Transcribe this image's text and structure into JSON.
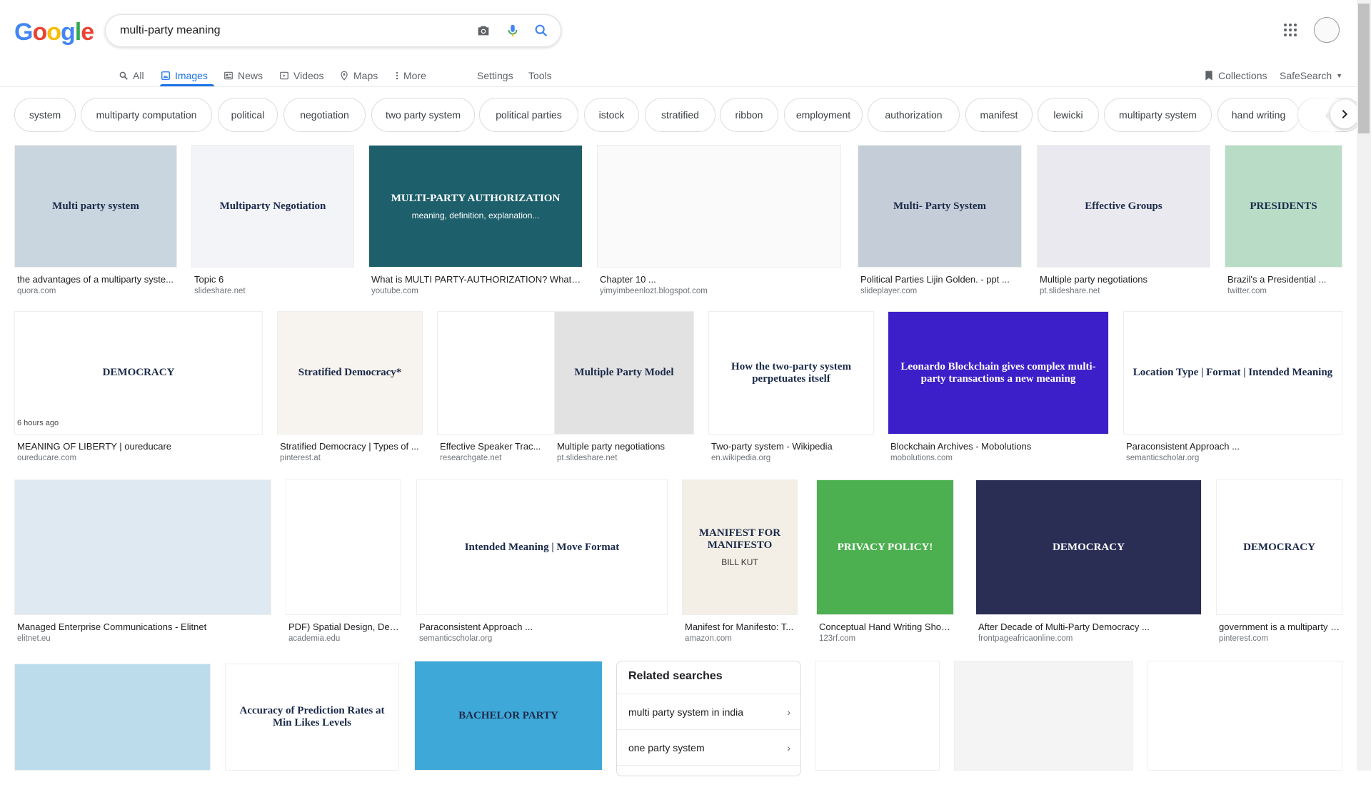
{
  "logo_letters": [
    "G",
    "o",
    "o",
    "g",
    "l",
    "e"
  ],
  "search": {
    "query": "multi-party meaning"
  },
  "tabs": [
    {
      "label": "All",
      "icon": "search-icon"
    },
    {
      "label": "Images",
      "icon": "image-icon"
    },
    {
      "label": "News",
      "icon": "news-icon"
    },
    {
      "label": "Videos",
      "icon": "video-icon"
    },
    {
      "label": "Maps",
      "icon": "map-pin-icon"
    },
    {
      "label": "More",
      "icon": "more-vert-icon"
    }
  ],
  "tools": {
    "settings": "Settings",
    "tools": "Tools",
    "collections": "Collections",
    "safesearch": "SafeSearch"
  },
  "chips": [
    "system",
    "multiparty computation",
    "political",
    "negotiation",
    "two party system",
    "political parties",
    "istock",
    "stratified",
    "ribbon",
    "employment",
    "authorization",
    "manifest",
    "lewicki",
    "multiparty system",
    "hand writing",
    "el"
  ],
  "results": [
    {
      "title": "the advantages of a multiparty syste...",
      "source": "quora.com",
      "thumb": {
        "bg": "#c9d6df",
        "text": "Multi party system"
      }
    },
    {
      "title": "Topic 6",
      "source": "slideshare.net",
      "thumb": {
        "bg": "#f2f4f7",
        "text": "Multiparty Negotiation"
      }
    },
    {
      "title": "What is MULTI PARTY-AUTHORIZATION? What ...",
      "source": "youtube.com",
      "thumb": {
        "bg": "#1d5f6b",
        "text": "MULTI-PARTY AUTHORIZATION",
        "sub": "meaning, definition, explanation..."
      }
    },
    {
      "title": "Chapter 10 ...",
      "source": "yimyimbeenlozt.blogspot.com",
      "thumb": {
        "bg": "#fafafa",
        "text": ""
      }
    },
    {
      "title": "Political Parties Lijin Golden. - ppt ...",
      "source": "slideplayer.com",
      "thumb": {
        "bg": "#c5ced8",
        "text": "Multi- Party System"
      }
    },
    {
      "title": "Multiple party negotiations",
      "source": "pt.slideshare.net",
      "thumb": {
        "bg": "#e9e9ef",
        "text": "Effective Groups"
      }
    },
    {
      "title": "Brazil's a Presidential ...",
      "source": "twitter.com",
      "thumb": {
        "bg": "#b8dcc6",
        "text": "PRESIDENTS"
      }
    },
    {
      "title": "MEANING OF LIBERTY | oureducare",
      "source": "oureducare.com",
      "thumb": {
        "bg": "#ffffff",
        "text": "DEMOCRACY"
      },
      "badge": "6 hours ago"
    },
    {
      "title": "Stratified Democracy | Types of ...",
      "source": "pinterest.at",
      "thumb": {
        "bg": "#f7f3ee",
        "text": "Stratified Democracy*"
      }
    },
    {
      "title": "Effective Speaker Trac...",
      "source": "researchgate.net",
      "thumb": {
        "bg": "#ffffff",
        "text": ""
      }
    },
    {
      "title": "Multiple party negotiations",
      "source": "pt.slideshare.net",
      "thumb": {
        "bg": "#e2e2e2",
        "text": "Multiple Party Model"
      }
    },
    {
      "title": "Two-party system - Wikipedia",
      "source": "en.wikipedia.org",
      "thumb": {
        "bg": "#ffffff",
        "text": "How the two-party system perpetuates itself"
      }
    },
    {
      "title": "Blockchain Archives - Mobolutions",
      "source": "mobolutions.com",
      "thumb": {
        "bg": "#3c1fc9",
        "text": "Leonardo Blockchain gives complex multi-party transactions a new meaning"
      }
    },
    {
      "title": "Paraconsistent Approach ...",
      "source": "semanticscholar.org",
      "thumb": {
        "bg": "#ffffff",
        "text": "Location Type | Format | Intended Meaning"
      }
    },
    {
      "title": "Managed Enterprise Communications - Elitnet",
      "source": "elitnet.eu",
      "thumb": {
        "bg": "#dfe9f1",
        "text": ""
      }
    },
    {
      "title": "PDF) Spatial Design, Des...",
      "source": "academia.edu",
      "thumb": {
        "bg": "#ffffff",
        "text": ""
      }
    },
    {
      "title": "Paraconsistent Approach ...",
      "source": "semanticscholar.org",
      "thumb": {
        "bg": "#ffffff",
        "text": "Intended Meaning | Move Format"
      }
    },
    {
      "title": "Manifest for Manifesto: T...",
      "source": "amazon.com",
      "thumb": {
        "bg": "#f3efe6",
        "text": "MANIFEST FOR MANIFESTO",
        "sub": "BILL KUT"
      }
    },
    {
      "title": "Conceptual Hand Writing Showin...",
      "source": "123rf.com",
      "thumb": {
        "bg": "#4caf50",
        "text": "PRIVACY POLICY!"
      }
    },
    {
      "title": "After Decade of Multi-Party Democracy ...",
      "source": "frontpageafricaonline.com",
      "thumb": {
        "bg": "#2a2e55",
        "text": "DEMOCRACY"
      }
    },
    {
      "title": "government is a multiparty d...",
      "source": "pinterest.com",
      "thumb": {
        "bg": "#ffffff",
        "text": "DEMOCRACY"
      }
    },
    {
      "title": "",
      "source": "",
      "thumb": {
        "bg": "#bcdcec",
        "text": ""
      }
    },
    {
      "title": "",
      "source": "",
      "thumb": {
        "bg": "#ffffff",
        "text": "Accuracy of Prediction Rates at Min Likes Levels"
      }
    },
    {
      "title": "",
      "source": "",
      "thumb": {
        "bg": "#3ea8d8",
        "text": "BACHELOR PARTY"
      }
    },
    {
      "title": "",
      "source": "",
      "thumb": {
        "bg": "#ffffff",
        "text": ""
      }
    },
    {
      "title": "",
      "source": "",
      "thumb": {
        "bg": "#f4f4f4",
        "text": ""
      }
    },
    {
      "title": "",
      "source": "",
      "thumb": {
        "bg": "#ffffff",
        "text": ""
      }
    }
  ],
  "related": {
    "title": "Related searches",
    "items": [
      "multi party system in india",
      "one party system"
    ]
  }
}
